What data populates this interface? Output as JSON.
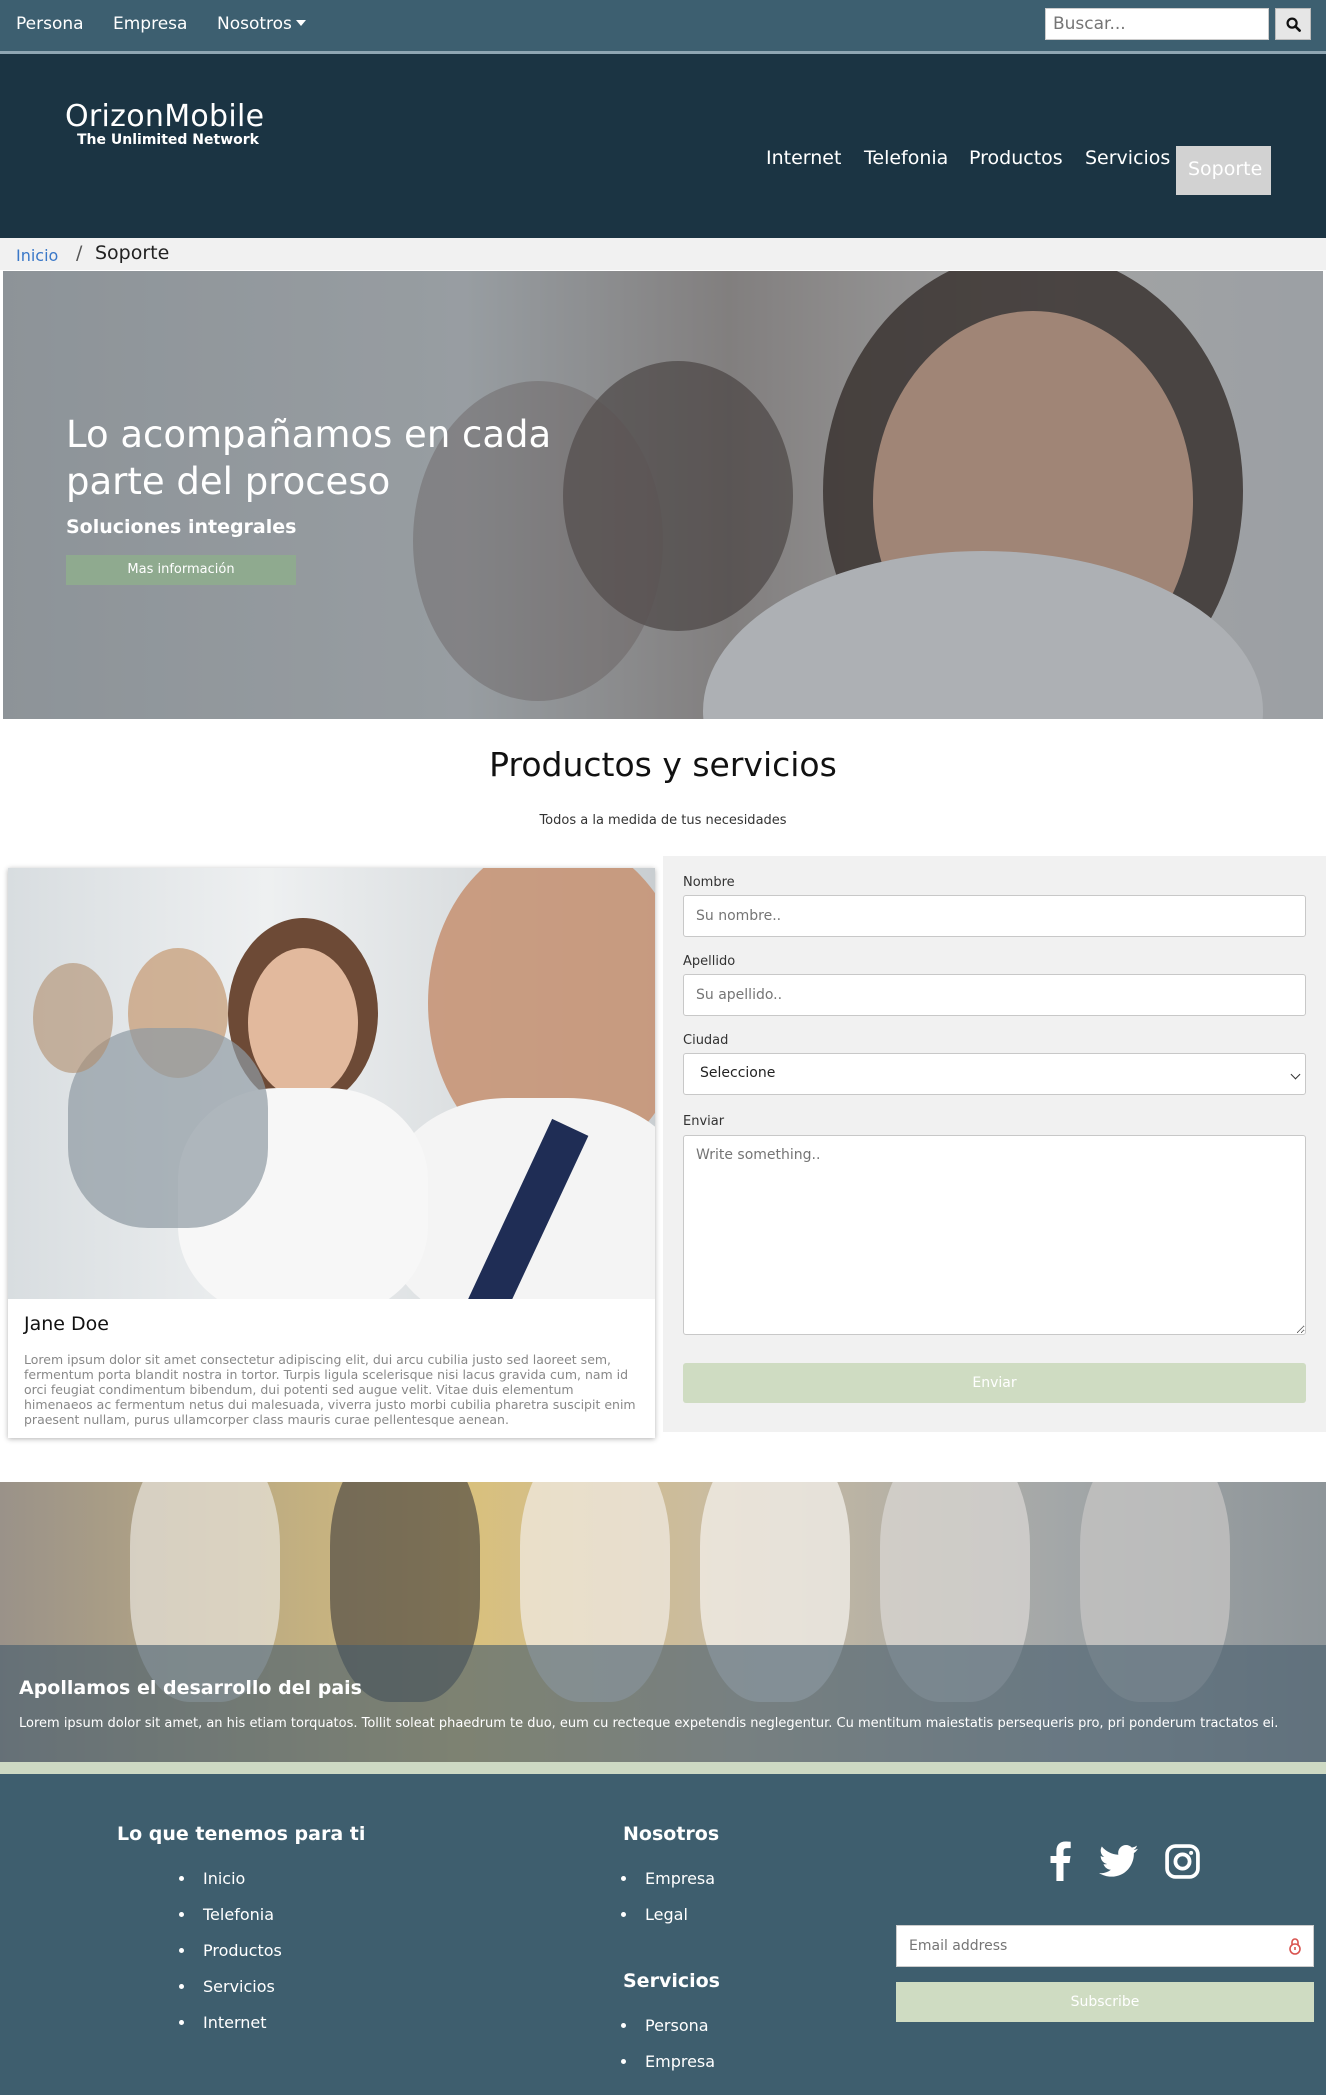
{
  "topbar": {
    "persona": "Persona",
    "empresa": "Empresa",
    "nosotros": "Nosotros",
    "search_placeholder": "Buscar..."
  },
  "brand": {
    "name": "OrizonMobile",
    "tagline": "The Unlimited Network"
  },
  "nav": {
    "items": [
      "Internet",
      "Telefonia",
      "Productos",
      "Servicios",
      "Soporte"
    ],
    "active": "Soporte"
  },
  "breadcrumb": {
    "home": "Inicio",
    "separator": "/",
    "current": "Soporte"
  },
  "hero": {
    "heading": "Lo acompañamos en cada parte del proceso",
    "subheading": "Soluciones integrales",
    "button": "Mas información"
  },
  "section": {
    "title": "Productos y servicios",
    "subtitle": "Todos a la medida de tus necesidades"
  },
  "card": {
    "name": "Jane Doe",
    "text": "Lorem ipsum dolor sit amet consectetur adipiscing elit, dui arcu cubilia justo sed laoreet sem, fermentum porta blandit nostra in tortor. Turpis ligula scelerisque nisi lacus gravida cum, nam id orci feugiat condimentum bibendum, dui potenti sed augue velit. Vitae duis elementum himenaeos ac fermentum netus dui malesuada, viverra justo morbi cubilia pharetra suscipit enim praesent nullam, purus ullamcorper class mauris curae pellentesque aenean."
  },
  "form": {
    "nombre_label": "Nombre",
    "nombre_placeholder": "Su nombre..",
    "apellido_label": "Apellido",
    "apellido_placeholder": "Su apellido..",
    "ciudad_label": "Ciudad",
    "ciudad_value": "Seleccione",
    "enviar_label": "Enviar",
    "message_placeholder": "Write something..",
    "submit": "Enviar"
  },
  "band": {
    "heading": "Apollamos el desarrollo del pais",
    "text": "Lorem ipsum dolor sit amet, an his etiam torquatos. Tollit soleat phaedrum te duo, eum cu recteque expetendis neglegentur. Cu mentitum maiestatis persequeris pro, pri ponderum tractatos ei."
  },
  "footer": {
    "col1_title": "Lo que tenemos para ti",
    "col1_items": [
      "Inicio",
      "Telefonia",
      "Productos",
      "Servicios",
      "Internet"
    ],
    "col2_title": "Nosotros",
    "col2_items": [
      "Empresa",
      "Legal"
    ],
    "col3_title": "Servicios",
    "col3_items": [
      "Persona",
      "Empresa"
    ],
    "social_icons": [
      "facebook-icon",
      "twitter-icon",
      "instagram-icon"
    ],
    "email_placeholder": "Email address",
    "subscribe": "Subscribe"
  },
  "colors": {
    "topbar": "#3d5f70",
    "header": "#1b3443",
    "footer": "#3e5e6e",
    "button_green": "#8faa8f",
    "light_green": "#cfdcc2"
  }
}
